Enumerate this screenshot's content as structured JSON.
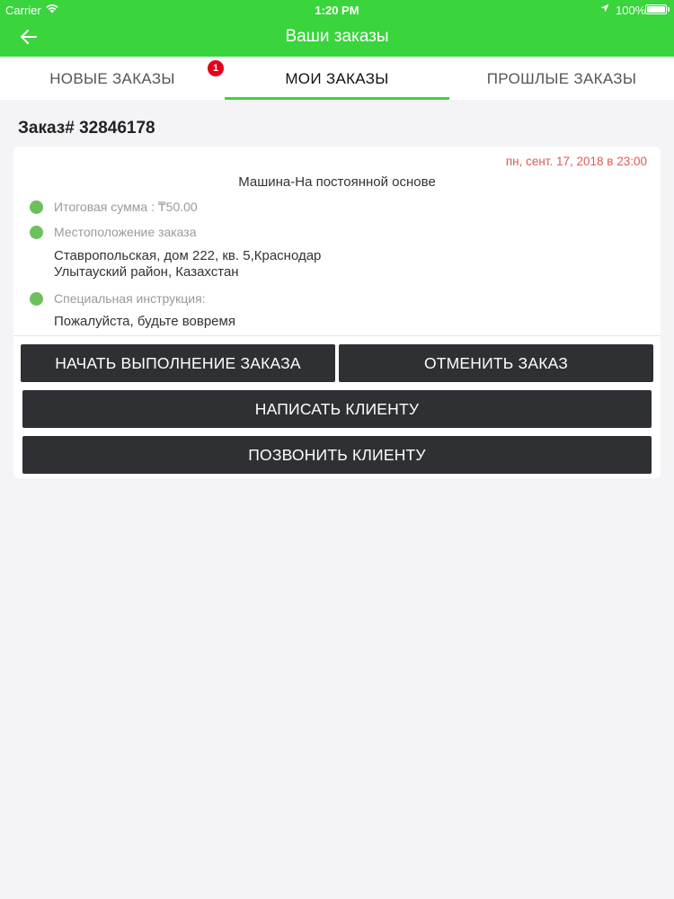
{
  "status_bar": {
    "carrier": "Carrier",
    "time": "1:20 PM",
    "battery": "100%"
  },
  "header": {
    "title": "Ваши заказы",
    "back_icon": "arrow-left-icon",
    "color": "#3ad43d"
  },
  "tabs": [
    {
      "label": "НОВЫЕ ЗАКАЗЫ",
      "badge": "1",
      "active": false
    },
    {
      "label": "МОИ ЗАКАЗЫ",
      "active": true
    },
    {
      "label": "ПРОШЛЫЕ ЗАКАЗЫ",
      "active": false
    }
  ],
  "order": {
    "heading": "Заказ# 32846178",
    "date": "пн, сент. 17, 2018 в 23:00",
    "service": "Машина-На постоянной основе",
    "total_label": "Итоговая сумма : ₸50.00",
    "location_label": "Местоположение заказа",
    "address_line1": "Ставропольская, дом 222, кв. 5,Краснодар",
    "address_line2": "Улытауский район,  Казахстан",
    "instruction_label": "Специальная инструкция:",
    "instruction_value": "Пожалуйста, будьте вовремя"
  },
  "actions": {
    "start": "НАЧАТЬ ВЫПОЛНЕНИЕ ЗАКАЗА",
    "cancel": "ОТМЕНИТЬ ЗАКАЗ",
    "message": "НАПИСАТЬ КЛИЕНТУ",
    "call": "ПОЗВОНИТЬ КЛИЕНТУ"
  },
  "colors": {
    "accent": "#3ad43d",
    "badge": "#e3001b",
    "date": "#e05a4f",
    "dot": "#6cc15a",
    "button": "#2e3033"
  }
}
